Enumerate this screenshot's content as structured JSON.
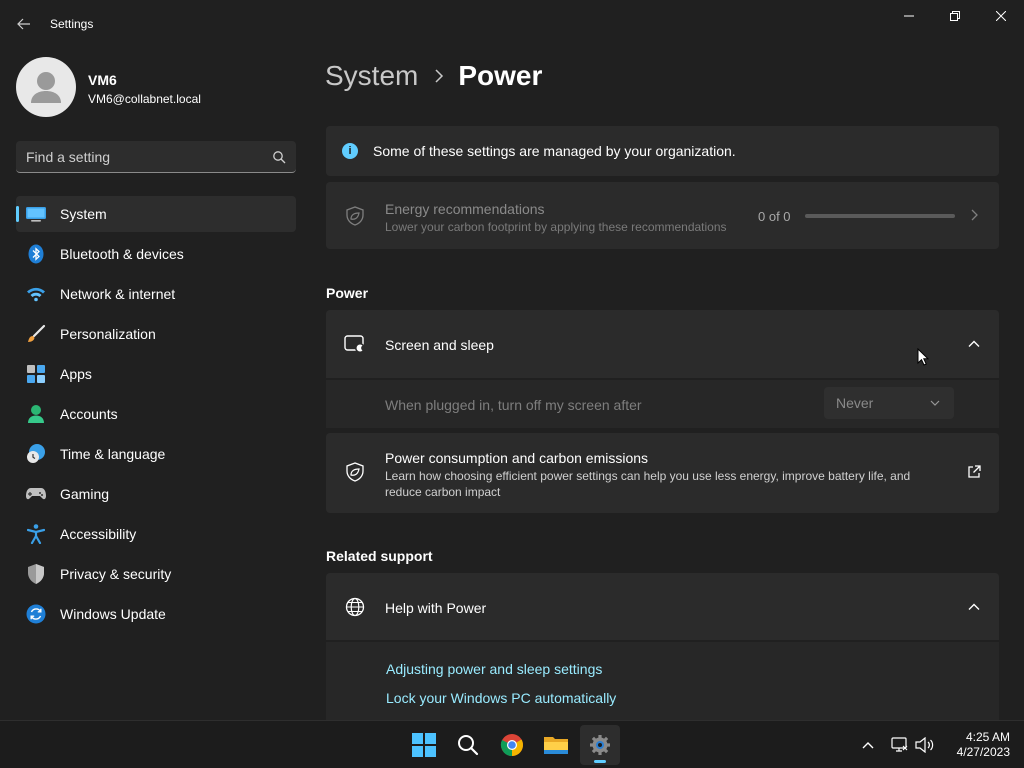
{
  "window": {
    "title": "Settings"
  },
  "profile": {
    "name": "VM6",
    "email": "VM6@collabnet.local"
  },
  "search": {
    "placeholder": "Find a setting"
  },
  "sidebar": {
    "items": [
      {
        "label": "System",
        "icon": "system-icon",
        "active": true
      },
      {
        "label": "Bluetooth & devices",
        "icon": "bluetooth-icon"
      },
      {
        "label": "Network & internet",
        "icon": "wifi-icon"
      },
      {
        "label": "Personalization",
        "icon": "brush-icon"
      },
      {
        "label": "Apps",
        "icon": "apps-icon"
      },
      {
        "label": "Accounts",
        "icon": "accounts-icon"
      },
      {
        "label": "Time & language",
        "icon": "clock-globe-icon"
      },
      {
        "label": "Gaming",
        "icon": "gamepad-icon"
      },
      {
        "label": "Accessibility",
        "icon": "accessibility-icon"
      },
      {
        "label": "Privacy & security",
        "icon": "shield-icon"
      },
      {
        "label": "Windows Update",
        "icon": "update-icon"
      }
    ]
  },
  "breadcrumb": {
    "parent": "System",
    "current": "Power"
  },
  "info_banner": {
    "text": "Some of these settings are managed by your organization."
  },
  "energy": {
    "title": "Energy recommendations",
    "subtitle": "Lower your carbon footprint by applying these recommendations",
    "count": "0 of 0",
    "progress": 0
  },
  "power_section": {
    "title": "Power",
    "screen_sleep": {
      "title": "Screen and sleep",
      "plugged_label": "When plugged in, turn off my screen after",
      "plugged_value": "Never"
    },
    "consumption": {
      "title": "Power consumption and carbon emissions",
      "description": "Learn how choosing efficient power settings can help you use less energy, improve battery life, and reduce carbon impact"
    }
  },
  "related_support": {
    "title": "Related support",
    "help_title": "Help with Power",
    "links": [
      "Adjusting power and sleep settings",
      "Lock your Windows PC automatically"
    ]
  },
  "taskbar": {
    "apps": [
      "start-icon",
      "search-icon",
      "chrome-icon",
      "file-explorer-icon",
      "settings-icon"
    ],
    "time": "4:25 AM",
    "date": "4/27/2023"
  },
  "colors": {
    "accent": "#60cdff",
    "background": "#202020",
    "card": "#2b2b2b",
    "link": "#99ebff"
  }
}
